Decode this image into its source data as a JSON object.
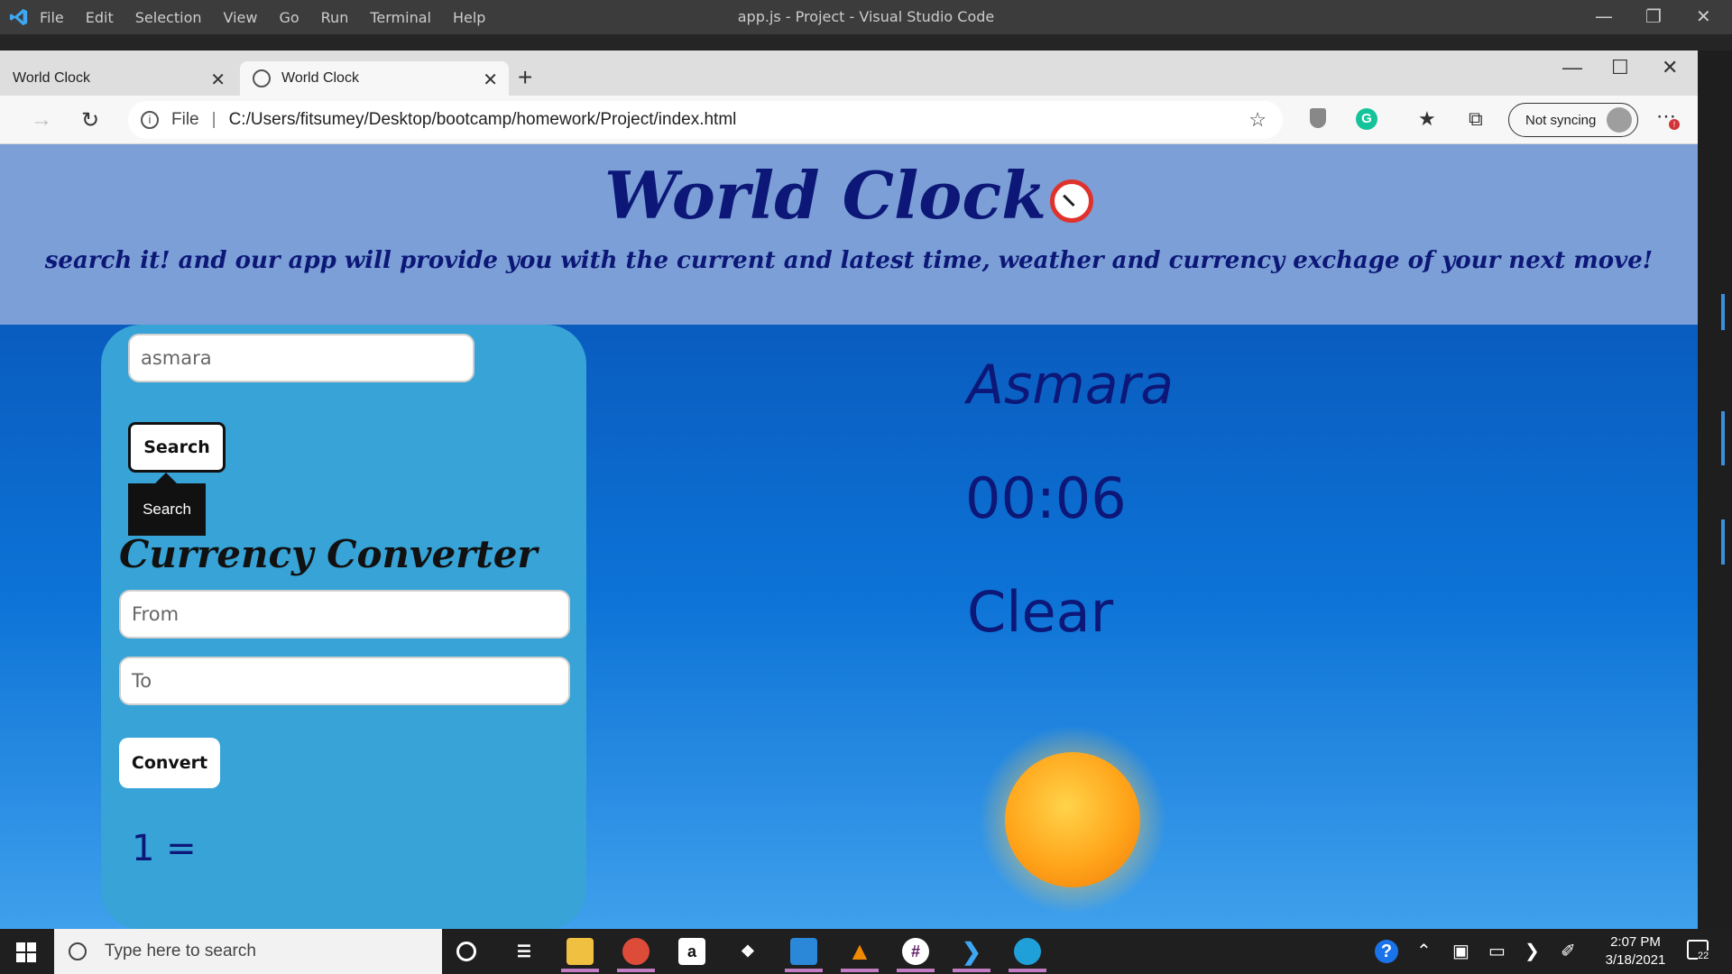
{
  "vscode": {
    "menu": [
      "File",
      "Edit",
      "Selection",
      "View",
      "Go",
      "Run",
      "Terminal",
      "Help"
    ],
    "window_title": "app.js - Project - Visual Studio Code"
  },
  "browser": {
    "tabs": [
      {
        "title": "World Clock"
      },
      {
        "title": "World Clock"
      }
    ],
    "address": {
      "scheme_label": "File",
      "url": "C:/Users/fitsumey/Desktop/bootcamp/homework/Project/index.html"
    },
    "sync_label": "Not syncing",
    "notification_badge": "!"
  },
  "page": {
    "title": "World Clock",
    "tagline": "search it! and our app will provide you with the current and latest time, weather and currency exchage of your next move!",
    "search": {
      "value": "asmara",
      "button_label": "Search",
      "tooltip": "Search"
    },
    "converter": {
      "title": "Currency Converter",
      "from_placeholder": "From",
      "to_placeholder": "To",
      "button_label": "Convert",
      "result": "1 ="
    },
    "city": {
      "name": "Asmara",
      "time": "00:06",
      "weather": "Clear"
    },
    "colors": {
      "header_bg": "#7b9fd6",
      "text_dark": "#0d1777",
      "panel_bg": "#37a3d6"
    }
  },
  "taskbar": {
    "search_placeholder": "Type here to search",
    "time": "2:07 PM",
    "date": "3/18/2021",
    "notification_count": "22",
    "apps": [
      "cortana-icon",
      "task-view-icon",
      "file-explorer-icon",
      "chrome-icon",
      "amazon-icon",
      "dropbox-icon",
      "photos-icon",
      "vlc-icon",
      "slack-icon",
      "vscode-icon",
      "edge-icon"
    ]
  }
}
